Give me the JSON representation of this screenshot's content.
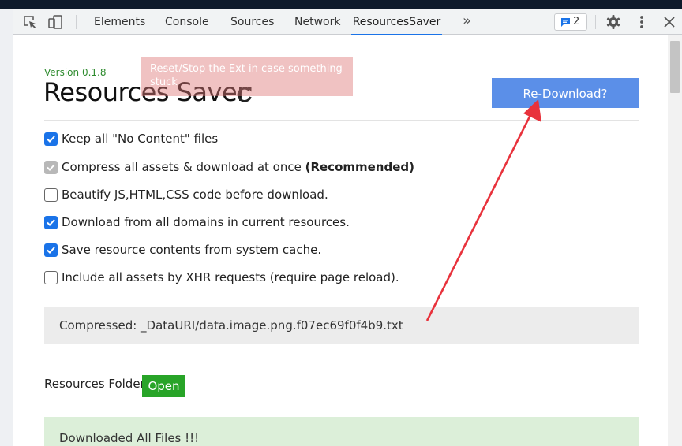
{
  "devtools": {
    "tabs": [
      "Elements",
      "Console",
      "Sources",
      "Network",
      "ResourcesSaver"
    ],
    "active_tab": "ResourcesSaver",
    "more_tabs_glyph": "»",
    "issues_count": "2",
    "icons": [
      "inspect-element-icon",
      "device-toggle-icon",
      "chat-icon",
      "gear-icon",
      "kebab-menu-icon",
      "close-icon"
    ]
  },
  "ext": {
    "version": "Version 0.1.8",
    "title": "Resources Saver",
    "tooltip": "Reset/Stop the Ext in case something stuck",
    "redownload_label": "Re-Download?",
    "options": [
      {
        "label": "Keep all \"No Content\" files",
        "bold": "",
        "state": "checked"
      },
      {
        "label": "Compress all assets & download at once ",
        "bold": "(Recommended)",
        "state": "disabled-checked"
      },
      {
        "label": "Beautify JS,HTML,CSS code before download.",
        "bold": "",
        "state": "unchecked"
      },
      {
        "label": "Download from all domains in current resources.",
        "bold": "",
        "state": "checked"
      },
      {
        "label": "Save resource contents from system cache.",
        "bold": "",
        "state": "checked"
      },
      {
        "label": "Include all assets by XHR requests (require page reload).",
        "bold": "",
        "state": "unchecked"
      }
    ],
    "status": "Compressed: _DataURI/data.image.png.f07ec69f0f4b9.txt",
    "folder_label": "Resources Folder:",
    "open_label": "Open",
    "downloaded": "Downloaded All Files !!!"
  },
  "colors": {
    "accent": "#1a73e8",
    "button_blue": "#5b8fe8",
    "open_green": "#28a428",
    "version_green": "#2e8b2e",
    "annotation_red": "#e8323c"
  }
}
